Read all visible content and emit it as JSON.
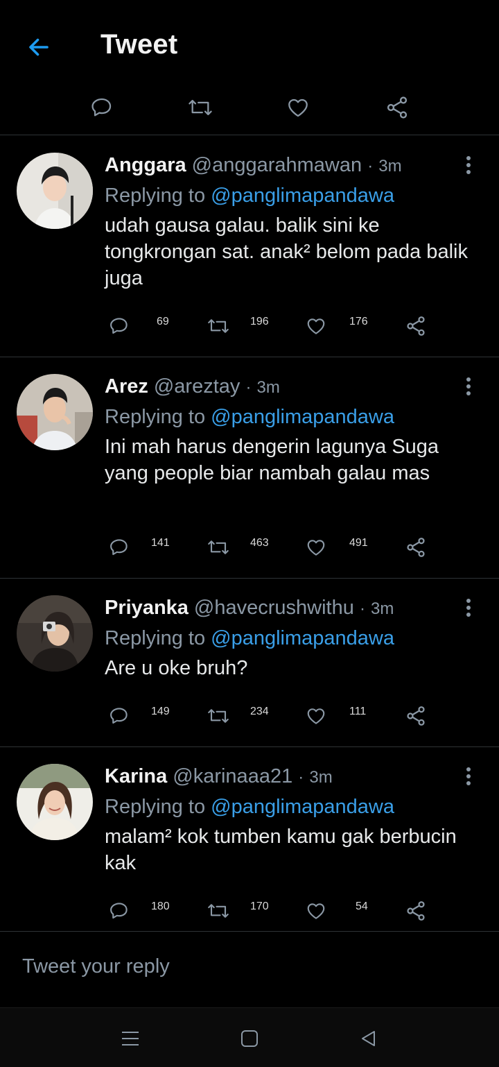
{
  "header": {
    "title": "Tweet",
    "back_icon": "arrow-left-icon",
    "accent": "#1d9bf0"
  },
  "top_actions": [
    "reply-icon",
    "retweet-icon",
    "like-icon",
    "share-icon"
  ],
  "tweets": [
    {
      "name": "Anggara",
      "handle": "@anggarahmawan",
      "dot": "·",
      "time": "3m",
      "replying_prefix": "Replying to",
      "replying_to": "@panglimapandawa",
      "text": "udah gausa galau. balik sini ke tongkrongan sat. anak² belom pada balik juga",
      "replies": "69",
      "retweets": "196",
      "likes": "176"
    },
    {
      "name": "Arez",
      "handle": "@areztay",
      "dot": "·",
      "time": "3m",
      "replying_prefix": "Replying to",
      "replying_to": "@panglimapandawa",
      "text": "Ini mah harus dengerin lagunya Suga yang people biar nambah galau mas",
      "replies": "141",
      "retweets": "463",
      "likes": "491"
    },
    {
      "name": "Priyanka",
      "handle": "@havecrushwithu",
      "dot": "·",
      "time": "3m",
      "replying_prefix": "Replying to",
      "replying_to": "@panglimapandawa",
      "text": "Are u oke bruh?",
      "replies": "149",
      "retweets": "234",
      "likes": "111"
    },
    {
      "name": "Karina",
      "handle": "@karinaaa21",
      "dot": "·",
      "time": "3m",
      "replying_prefix": "Replying to",
      "replying_to": "@panglimapandawa",
      "text": "malam² kok tumben kamu gak berbucin kak",
      "replies": "180",
      "retweets": "170",
      "likes": "54"
    }
  ],
  "compose": {
    "placeholder": "Tweet your reply"
  },
  "navbar": [
    "menu-icon",
    "home-square-icon",
    "back-triangle-icon"
  ]
}
